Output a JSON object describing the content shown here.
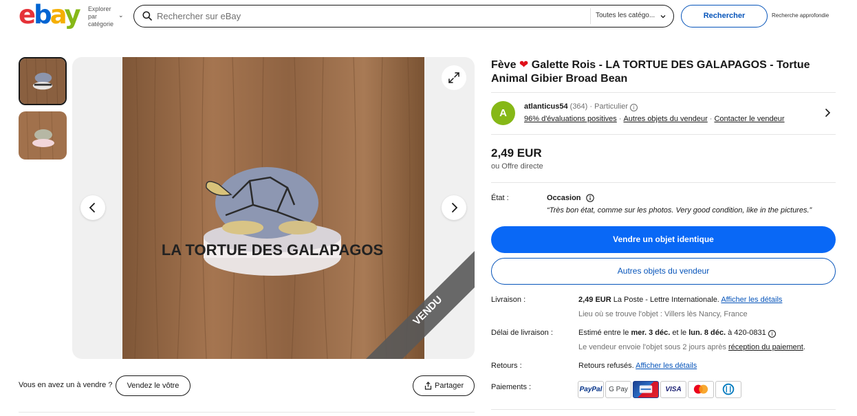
{
  "header": {
    "logo_letters": [
      "e",
      "b",
      "a",
      "y"
    ],
    "explore_label": "Explorer par catégorie",
    "search_placeholder": "Rechercher sur eBay",
    "category_selected": "Toutes les catégo...",
    "search_button": "Rechercher",
    "advanced_search": "Recherche approfondie"
  },
  "gallery": {
    "watermark": "VENDU",
    "photo_caption_text": "LA TORTUE DES GALAPAGOS"
  },
  "below_gallery": {
    "own_question": "Vous en avez un à vendre ?",
    "sell_yours_button": "Vendez le vôtre",
    "share_button": "Partager"
  },
  "listing": {
    "title_part1": "Fève",
    "title_part2": "Galette Rois - LA TORTUE DES GALAPAGOS - Tortue Animal Gibier Broad Bean",
    "seller": {
      "avatar_letter": "A",
      "name": "atlanticus54",
      "feedback_count": "(364)",
      "type": "Particulier",
      "positive_feedback": "96% d'évaluations positives",
      "other_items": "Autres objets du vendeur",
      "contact": "Contacter le vendeur"
    },
    "price": "2,49 EUR",
    "best_offer": "ou Offre directe",
    "condition_label": "État :",
    "condition_value": "Occasion",
    "condition_desc": "“Très bon état, comme sur les photos. Very good condition, like in the pictures.”",
    "primary_button": "Vendre un objet identique",
    "secondary_button": "Autres objets du vendeur"
  },
  "shipping": {
    "label": "Livraison :",
    "price": "2,49 EUR",
    "service": "La Poste - Lettre Internationale.",
    "details_link": "Afficher les détails",
    "location": "Lieu où se trouve l'objet : Villers lès Nancy, France"
  },
  "delivery": {
    "label": "Délai de livraison :",
    "text_prefix": "Estimé entre le",
    "date_start": "mer. 3 déc.",
    "text_mid": "et le",
    "date_end": "lun. 8 déc.",
    "text_suffix": "à 420-0831",
    "note_prefix": "Le vendeur envoie l'objet sous 2 jours après",
    "note_link": "réception du paiement",
    "note_end": "."
  },
  "returns": {
    "label": "Retours :",
    "text": "Retours refusés.",
    "link": "Afficher les détails"
  },
  "payments": {
    "label": "Paiements :",
    "methods": [
      "PayPal",
      "G Pay",
      "CB",
      "VISA",
      "Mastercard",
      "Diners Club"
    ]
  },
  "colors": {
    "brand_blue": "#0968f6",
    "link_blue": "#0654ba",
    "avatar_green": "#86b817",
    "heart_red": "#e0101a"
  }
}
